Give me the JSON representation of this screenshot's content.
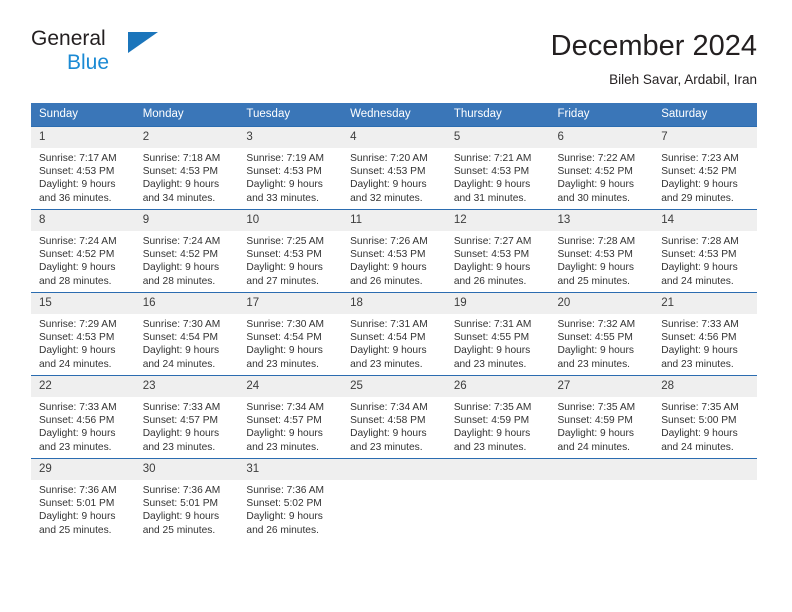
{
  "brand": {
    "name_top": "General",
    "name_bottom": "Blue",
    "triangle_color": "#1b75bb",
    "blue_text_color": "#1b8ad4"
  },
  "header": {
    "title": "December 2024",
    "subtitle": "Bileh Savar, Ardabil, Iran"
  },
  "calendar": {
    "header_bg": "#3a76b8",
    "row_border_color": "#2b6cb0",
    "daynum_bg": "#efefef",
    "weekdays": [
      "Sunday",
      "Monday",
      "Tuesday",
      "Wednesday",
      "Thursday",
      "Friday",
      "Saturday"
    ],
    "weeks": [
      [
        {
          "day": "1",
          "sunrise": "Sunrise: 7:17 AM",
          "sunset": "Sunset: 4:53 PM",
          "daylight_1": "Daylight: 9 hours",
          "daylight_2": "and 36 minutes."
        },
        {
          "day": "2",
          "sunrise": "Sunrise: 7:18 AM",
          "sunset": "Sunset: 4:53 PM",
          "daylight_1": "Daylight: 9 hours",
          "daylight_2": "and 34 minutes."
        },
        {
          "day": "3",
          "sunrise": "Sunrise: 7:19 AM",
          "sunset": "Sunset: 4:53 PM",
          "daylight_1": "Daylight: 9 hours",
          "daylight_2": "and 33 minutes."
        },
        {
          "day": "4",
          "sunrise": "Sunrise: 7:20 AM",
          "sunset": "Sunset: 4:53 PM",
          "daylight_1": "Daylight: 9 hours",
          "daylight_2": "and 32 minutes."
        },
        {
          "day": "5",
          "sunrise": "Sunrise: 7:21 AM",
          "sunset": "Sunset: 4:53 PM",
          "daylight_1": "Daylight: 9 hours",
          "daylight_2": "and 31 minutes."
        },
        {
          "day": "6",
          "sunrise": "Sunrise: 7:22 AM",
          "sunset": "Sunset: 4:52 PM",
          "daylight_1": "Daylight: 9 hours",
          "daylight_2": "and 30 minutes."
        },
        {
          "day": "7",
          "sunrise": "Sunrise: 7:23 AM",
          "sunset": "Sunset: 4:52 PM",
          "daylight_1": "Daylight: 9 hours",
          "daylight_2": "and 29 minutes."
        }
      ],
      [
        {
          "day": "8",
          "sunrise": "Sunrise: 7:24 AM",
          "sunset": "Sunset: 4:52 PM",
          "daylight_1": "Daylight: 9 hours",
          "daylight_2": "and 28 minutes."
        },
        {
          "day": "9",
          "sunrise": "Sunrise: 7:24 AM",
          "sunset": "Sunset: 4:52 PM",
          "daylight_1": "Daylight: 9 hours",
          "daylight_2": "and 28 minutes."
        },
        {
          "day": "10",
          "sunrise": "Sunrise: 7:25 AM",
          "sunset": "Sunset: 4:53 PM",
          "daylight_1": "Daylight: 9 hours",
          "daylight_2": "and 27 minutes."
        },
        {
          "day": "11",
          "sunrise": "Sunrise: 7:26 AM",
          "sunset": "Sunset: 4:53 PM",
          "daylight_1": "Daylight: 9 hours",
          "daylight_2": "and 26 minutes."
        },
        {
          "day": "12",
          "sunrise": "Sunrise: 7:27 AM",
          "sunset": "Sunset: 4:53 PM",
          "daylight_1": "Daylight: 9 hours",
          "daylight_2": "and 26 minutes."
        },
        {
          "day": "13",
          "sunrise": "Sunrise: 7:28 AM",
          "sunset": "Sunset: 4:53 PM",
          "daylight_1": "Daylight: 9 hours",
          "daylight_2": "and 25 minutes."
        },
        {
          "day": "14",
          "sunrise": "Sunrise: 7:28 AM",
          "sunset": "Sunset: 4:53 PM",
          "daylight_1": "Daylight: 9 hours",
          "daylight_2": "and 24 minutes."
        }
      ],
      [
        {
          "day": "15",
          "sunrise": "Sunrise: 7:29 AM",
          "sunset": "Sunset: 4:53 PM",
          "daylight_1": "Daylight: 9 hours",
          "daylight_2": "and 24 minutes."
        },
        {
          "day": "16",
          "sunrise": "Sunrise: 7:30 AM",
          "sunset": "Sunset: 4:54 PM",
          "daylight_1": "Daylight: 9 hours",
          "daylight_2": "and 24 minutes."
        },
        {
          "day": "17",
          "sunrise": "Sunrise: 7:30 AM",
          "sunset": "Sunset: 4:54 PM",
          "daylight_1": "Daylight: 9 hours",
          "daylight_2": "and 23 minutes."
        },
        {
          "day": "18",
          "sunrise": "Sunrise: 7:31 AM",
          "sunset": "Sunset: 4:54 PM",
          "daylight_1": "Daylight: 9 hours",
          "daylight_2": "and 23 minutes."
        },
        {
          "day": "19",
          "sunrise": "Sunrise: 7:31 AM",
          "sunset": "Sunset: 4:55 PM",
          "daylight_1": "Daylight: 9 hours",
          "daylight_2": "and 23 minutes."
        },
        {
          "day": "20",
          "sunrise": "Sunrise: 7:32 AM",
          "sunset": "Sunset: 4:55 PM",
          "daylight_1": "Daylight: 9 hours",
          "daylight_2": "and 23 minutes."
        },
        {
          "day": "21",
          "sunrise": "Sunrise: 7:33 AM",
          "sunset": "Sunset: 4:56 PM",
          "daylight_1": "Daylight: 9 hours",
          "daylight_2": "and 23 minutes."
        }
      ],
      [
        {
          "day": "22",
          "sunrise": "Sunrise: 7:33 AM",
          "sunset": "Sunset: 4:56 PM",
          "daylight_1": "Daylight: 9 hours",
          "daylight_2": "and 23 minutes."
        },
        {
          "day": "23",
          "sunrise": "Sunrise: 7:33 AM",
          "sunset": "Sunset: 4:57 PM",
          "daylight_1": "Daylight: 9 hours",
          "daylight_2": "and 23 minutes."
        },
        {
          "day": "24",
          "sunrise": "Sunrise: 7:34 AM",
          "sunset": "Sunset: 4:57 PM",
          "daylight_1": "Daylight: 9 hours",
          "daylight_2": "and 23 minutes."
        },
        {
          "day": "25",
          "sunrise": "Sunrise: 7:34 AM",
          "sunset": "Sunset: 4:58 PM",
          "daylight_1": "Daylight: 9 hours",
          "daylight_2": "and 23 minutes."
        },
        {
          "day": "26",
          "sunrise": "Sunrise: 7:35 AM",
          "sunset": "Sunset: 4:59 PM",
          "daylight_1": "Daylight: 9 hours",
          "daylight_2": "and 23 minutes."
        },
        {
          "day": "27",
          "sunrise": "Sunrise: 7:35 AM",
          "sunset": "Sunset: 4:59 PM",
          "daylight_1": "Daylight: 9 hours",
          "daylight_2": "and 24 minutes."
        },
        {
          "day": "28",
          "sunrise": "Sunrise: 7:35 AM",
          "sunset": "Sunset: 5:00 PM",
          "daylight_1": "Daylight: 9 hours",
          "daylight_2": "and 24 minutes."
        }
      ],
      [
        {
          "day": "29",
          "sunrise": "Sunrise: 7:36 AM",
          "sunset": "Sunset: 5:01 PM",
          "daylight_1": "Daylight: 9 hours",
          "daylight_2": "and 25 minutes."
        },
        {
          "day": "30",
          "sunrise": "Sunrise: 7:36 AM",
          "sunset": "Sunset: 5:01 PM",
          "daylight_1": "Daylight: 9 hours",
          "daylight_2": "and 25 minutes."
        },
        {
          "day": "31",
          "sunrise": "Sunrise: 7:36 AM",
          "sunset": "Sunset: 5:02 PM",
          "daylight_1": "Daylight: 9 hours",
          "daylight_2": "and 26 minutes."
        },
        {
          "day": "",
          "sunrise": "",
          "sunset": "",
          "daylight_1": "",
          "daylight_2": ""
        },
        {
          "day": "",
          "sunrise": "",
          "sunset": "",
          "daylight_1": "",
          "daylight_2": ""
        },
        {
          "day": "",
          "sunrise": "",
          "sunset": "",
          "daylight_1": "",
          "daylight_2": ""
        },
        {
          "day": "",
          "sunrise": "",
          "sunset": "",
          "daylight_1": "",
          "daylight_2": ""
        }
      ]
    ]
  }
}
